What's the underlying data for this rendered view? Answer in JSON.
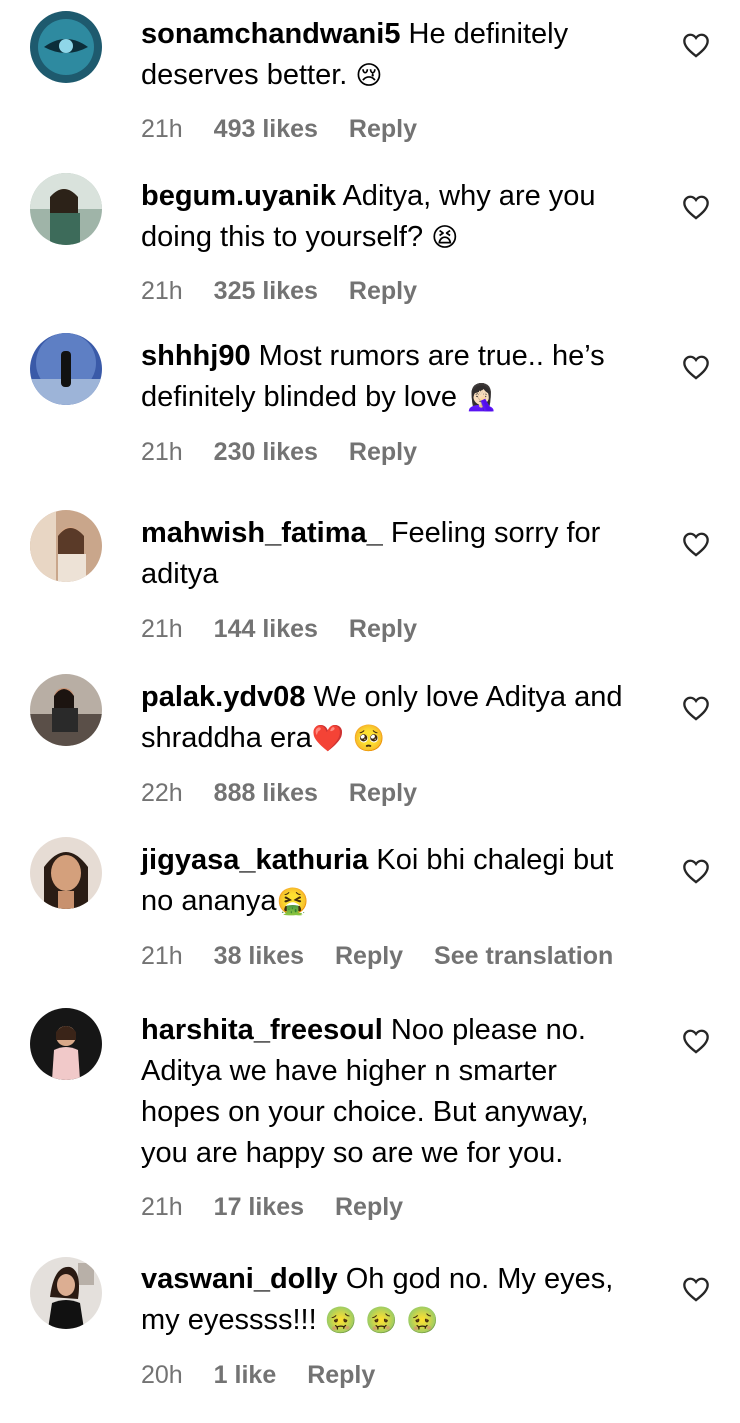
{
  "comments": [
    {
      "username": "sonamchandwani5",
      "text": "He definitely deserves better.",
      "emoji": "😢",
      "time": "21h",
      "likes": "493 likes",
      "reply": "Reply",
      "avatar_color": "#1e5a6e"
    },
    {
      "username": "begum.uyanik",
      "text": "Aditya, why are you doing this to yourself?",
      "emoji": "😫",
      "time": "21h",
      "likes": "325 likes",
      "reply": "Reply",
      "avatar_color": "#3d6b5a"
    },
    {
      "username": "shhhj90",
      "text": "Most rumors are true.. he’s definitely blinded by love",
      "emoji": "🤦🏻‍♀️",
      "time": "21h",
      "likes": "230 likes",
      "reply": "Reply",
      "avatar_color": "#5e7fc4"
    },
    {
      "username": "mahwish_fatima_",
      "text": "Feeling sorry for aditya",
      "emoji": "",
      "time": "21h",
      "likes": "144 likes",
      "reply": "Reply",
      "avatar_color": "#c9a68b"
    },
    {
      "username": "palak.ydv08",
      "text": "We only love Aditya and shraddha era",
      "emoji": "❤️ 🥺",
      "time": "22h",
      "likes": "888 likes",
      "reply": "Reply",
      "avatar_color": "#8a7e76"
    },
    {
      "username": "jigyasa_kathuria",
      "text": "Koi bhi chalegi but no ananya",
      "emoji": "🤮",
      "time": "21h",
      "likes": "38 likes",
      "reply": "Reply",
      "translation": "See translation",
      "avatar_color": "#5a3e30"
    },
    {
      "username": "harshita_freesoul",
      "text": "Noo please no. Aditya we have higher n smarter hopes on your choice. But anyway, you are happy so are we for you.",
      "emoji": "",
      "time": "21h",
      "likes": "17 likes",
      "reply": "Reply",
      "avatar_color": "#1a1a1a"
    },
    {
      "username": "vaswani_dolly",
      "text": "Oh god no. My eyes, my eyessss!!!",
      "emoji": "🤢 🤢 🤢",
      "time": "20h",
      "likes": "1 like",
      "reply": "Reply",
      "avatar_color": "#d8d2cc"
    }
  ]
}
